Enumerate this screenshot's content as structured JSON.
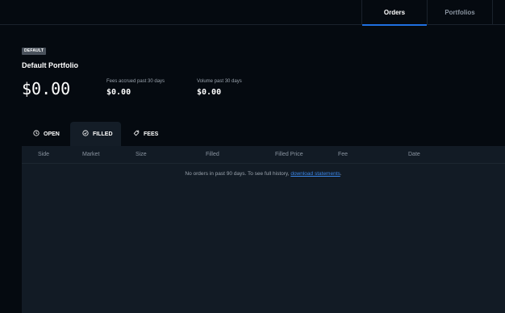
{
  "nav": {
    "orders_label": "Orders",
    "portfolios_label": "Portfolios"
  },
  "portfolio": {
    "badge": "DEFAULT",
    "title": "Default Portfolio",
    "balance": "$0.00",
    "fees_label": "Fees accrued past 30 days",
    "fees_value": "$0.00",
    "volume_label": "Volume past 30 days",
    "volume_value": "$0.00"
  },
  "order_tabs": {
    "open": "OPEN",
    "filled": "FILLED",
    "fees": "FEES",
    "selected": "FILLED"
  },
  "table": {
    "columns": [
      "Side",
      "Market",
      "Size",
      "Filled",
      "Filled Price",
      "Fee",
      "Date"
    ],
    "empty_text": "No orders in past 90 days. To see full history, ",
    "empty_link": "download statements",
    "empty_end": "."
  },
  "colors": {
    "accent": "#1f6fe0",
    "background": "#050a10",
    "panel": "#121b25",
    "link": "#3a86e8"
  }
}
